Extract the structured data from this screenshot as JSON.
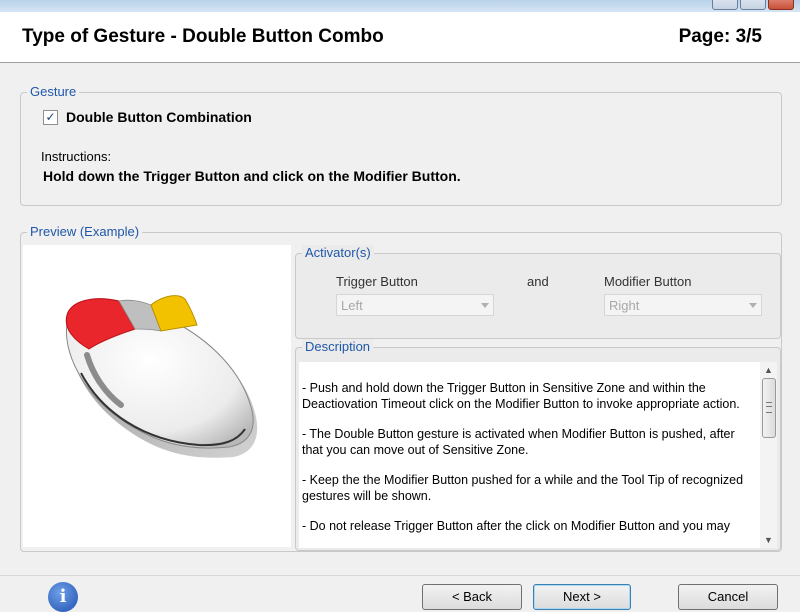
{
  "header": {
    "title": "Type of Gesture - Double Button Combo",
    "page": "Page: 3/5"
  },
  "gesture": {
    "legend": "Gesture",
    "checkbox_label": "Double Button Combination",
    "checkbox_checked": true,
    "instructions_label": "Instructions:",
    "instructions_text": "Hold down the Trigger Button and click on the Modifier Button."
  },
  "preview": {
    "legend": "Preview (Example)",
    "mouse_colors": {
      "trigger": "#e8262b",
      "modifier": "#f2c200",
      "body": "#f4f4f4"
    }
  },
  "activators": {
    "legend": "Activator(s)",
    "trigger_label": "Trigger Button",
    "trigger_value": "Left",
    "and_label": "and",
    "modifier_label": "Modifier Button",
    "modifier_value": "Right"
  },
  "description": {
    "legend": "Description",
    "paragraphs": [
      "- Push and hold down the Trigger Button in Sensitive Zone and within the Deactiovation Timeout click on the Modifier Button to invoke appropriate action.",
      "- The Double Button gesture is activated when Modifier Button is pushed, after that you can move out of Sensitive Zone.",
      "- Keep the the Modifier Button pushed for a while and the Tool Tip of recognized gestures will be shown.",
      "- Do not release Trigger Button after the click on Modifier Button and you may"
    ]
  },
  "footer": {
    "info_icon": "info-icon",
    "back_label": "< Back",
    "next_label": "Next >",
    "cancel_label": "Cancel"
  }
}
